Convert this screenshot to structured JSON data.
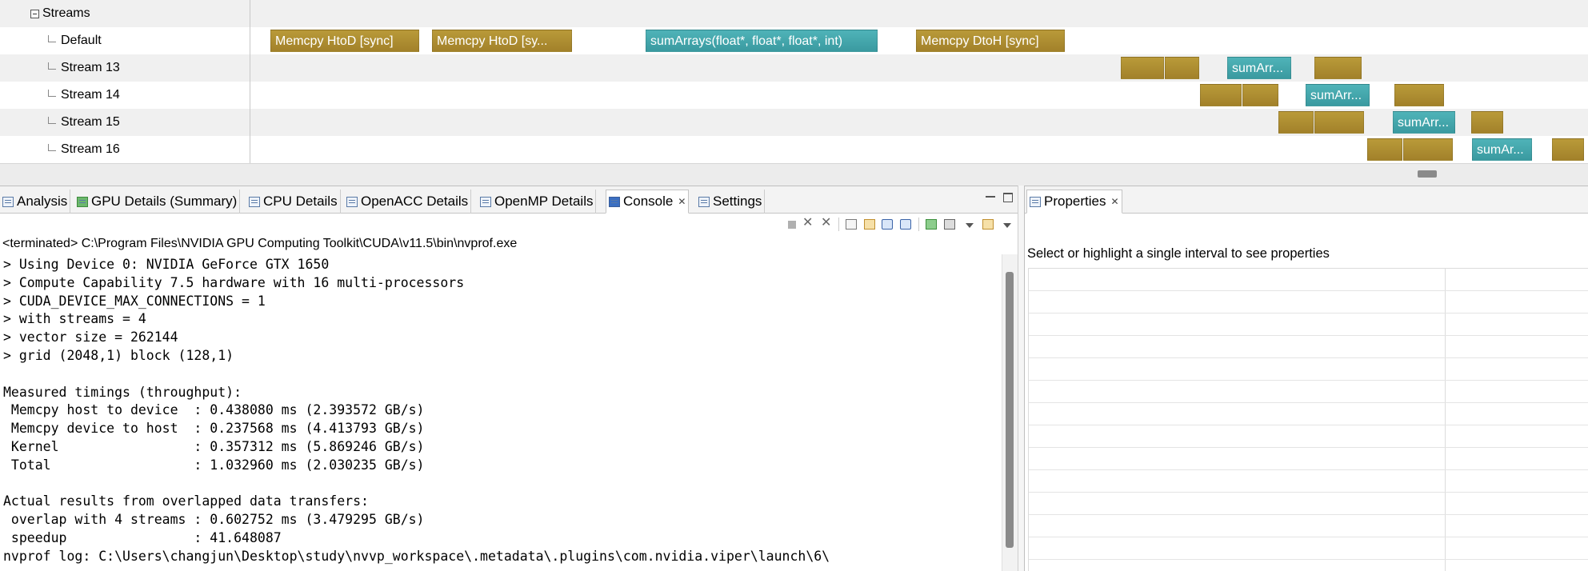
{
  "timeline": {
    "group_label": "Streams",
    "rows": [
      {
        "label": "Default",
        "segments": [
          {
            "kind": "memcpy",
            "text": "Memcpy HtoD [sync]"
          },
          {
            "kind": "memcpy",
            "text": "Memcpy HtoD [sy..."
          },
          {
            "kind": "kernel",
            "text": "sumArrays(float*, float*, float*, int)"
          },
          {
            "kind": "memcpy",
            "text": "Memcpy DtoH [sync]"
          }
        ]
      },
      {
        "label": "Stream 13",
        "segments": [
          {
            "kind": "memcpy",
            "text": ""
          },
          {
            "kind": "memcpy",
            "text": ""
          },
          {
            "kind": "kernel",
            "text": "sumArr..."
          },
          {
            "kind": "memcpy",
            "text": ""
          }
        ]
      },
      {
        "label": "Stream 14",
        "segments": [
          {
            "kind": "memcpy",
            "text": ""
          },
          {
            "kind": "memcpy",
            "text": ""
          },
          {
            "kind": "kernel",
            "text": "sumArr..."
          },
          {
            "kind": "memcpy",
            "text": ""
          }
        ]
      },
      {
        "label": "Stream 15",
        "segments": [
          {
            "kind": "memcpy",
            "text": ""
          },
          {
            "kind": "memcpy",
            "text": ""
          },
          {
            "kind": "kernel",
            "text": "sumArr..."
          },
          {
            "kind": "memcpy",
            "text": ""
          }
        ]
      },
      {
        "label": "Stream 16",
        "segments": [
          {
            "kind": "memcpy",
            "text": ""
          },
          {
            "kind": "memcpy",
            "text": ""
          },
          {
            "kind": "kernel",
            "text": "sumAr..."
          },
          {
            "kind": "memcpy",
            "text": ""
          }
        ]
      }
    ]
  },
  "left_tabs": [
    {
      "label": "Analysis",
      "icon": "analysis-icon"
    },
    {
      "label": "GPU Details (Summary)",
      "icon": "gpu-details-icon"
    },
    {
      "label": "CPU Details",
      "icon": "cpu-details-icon"
    },
    {
      "label": "OpenACC Details",
      "icon": "openacc-details-icon"
    },
    {
      "label": "OpenMP Details",
      "icon": "openmp-details-icon"
    },
    {
      "label": "Console",
      "icon": "console-icon",
      "active": true
    },
    {
      "label": "Settings",
      "icon": "settings-icon"
    }
  ],
  "console": {
    "title": "<terminated> C:\\Program Files\\NVIDIA GPU Computing Toolkit\\CUDA\\v11.5\\bin\\nvprof.exe",
    "lines": [
      "> Using Device 0: NVIDIA GeForce GTX 1650",
      "> Compute Capability 7.5 hardware with 16 multi-processors",
      "> CUDA_DEVICE_MAX_CONNECTIONS = 1",
      "> with streams = 4",
      "> vector size = 262144",
      "> grid (2048,1) block (128,1)",
      "",
      "Measured timings (throughput):",
      " Memcpy host to device  : 0.438080 ms (2.393572 GB/s)",
      " Memcpy device to host  : 0.237568 ms (4.413793 GB/s)",
      " Kernel                 : 0.357312 ms (5.869246 GB/s)",
      " Total                  : 1.032960 ms (2.030235 GB/s)",
      "",
      "Actual results from overlapped data transfers:",
      " overlap with 4 streams : 0.602752 ms (3.479295 GB/s)",
      " speedup                : 41.648087",
      "nvprof log: C:\\Users\\changjun\\Desktop\\study\\nvvp_workspace\\.metadata\\.plugins\\com.nvidia.viper\\launch\\6\\"
    ]
  },
  "properties": {
    "tab_label": "Properties",
    "hint": "Select or highlight a single interval to see properties"
  }
}
